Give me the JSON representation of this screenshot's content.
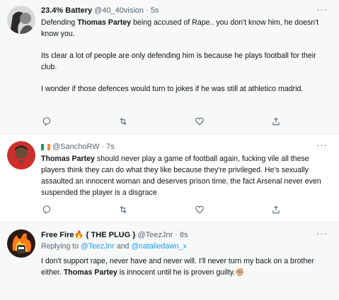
{
  "tweets": [
    {
      "display_name": "23.4% Battery",
      "handle": "@40_40vision",
      "time": "5s",
      "p1a": "Defending ",
      "p1b": "Thomas Partey",
      "p1c": " being accused of Rape.. you don't know him, he doesn't know you.",
      "p2": "Its clear a lot of people are only defending him is because he plays football for their club.",
      "p3": "I wonder if those defences would turn to jokes if he was still at athletico madrid."
    },
    {
      "display_name": "@SanchoRW",
      "time": "7s",
      "ta": "Thomas Partey",
      "tb": " should never play a game of football again, fucking vile all these players think they can do what they like because they're privileged. He's sexually assaulted an innocent woman and deserves prison time, the fact Arsenal never even suspended the player is a disgrace"
    },
    {
      "display_name": "Free Fire🔥 { THE PLUG }",
      "handle": "@TeezJnr",
      "time": "8s",
      "replying_label": "Replying to ",
      "reply_user1": "@TeezJnr",
      "reply_and": " and ",
      "reply_user2": "@nataliedawn_x",
      "ta": "I don't support rape, never have and never will. I'll never turn my back on a brother either. ",
      "tb": "Thomas Partey",
      "tc": " is innocent until he is proven guilty.",
      "emoji": "✊🏼"
    }
  ],
  "more_label": "···",
  "dot": "·",
  "icons": [
    "reply-icon",
    "retweet-icon",
    "like-icon",
    "share-icon"
  ],
  "colors": {
    "text": "#0f1419",
    "secondary": "#536471",
    "link": "#1d9bf0",
    "flag_green": "#169b62",
    "flag_white": "#ffffff",
    "flag_orange": "#ff883e"
  }
}
